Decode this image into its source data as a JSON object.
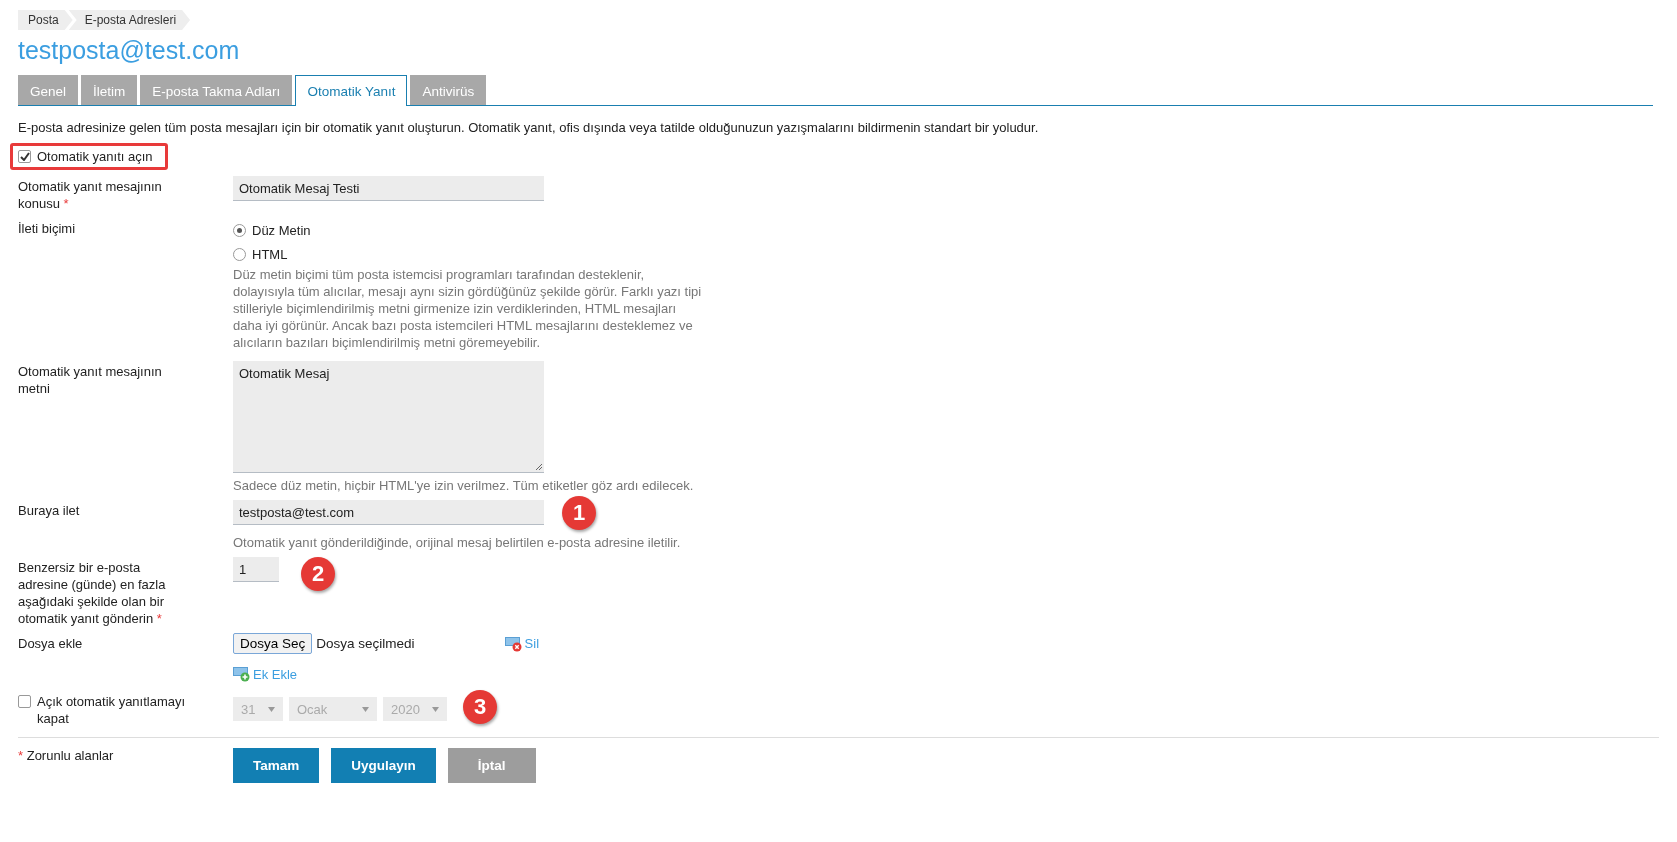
{
  "breadcrumbs": [
    "Posta",
    "E-posta Adresleri"
  ],
  "title": "testposta@test.com",
  "tabs": [
    {
      "label": "Genel",
      "selected": false
    },
    {
      "label": "İletim",
      "selected": false
    },
    {
      "label": "E-posta Takma Adları",
      "selected": false
    },
    {
      "label": "Otomatik Yanıt",
      "selected": true
    },
    {
      "label": "Antivirüs",
      "selected": false
    }
  ],
  "description": "E-posta adresinize gelen tüm posta mesajları için bir otomatik yanıt oluşturun. Otomatik yanıt, ofis dışında veya tatilde olduğunuzun yazışmalarını bildirmenin standart bir yoludur.",
  "enable_checkbox": {
    "label": "Otomatik yanıtı açın",
    "checked": true,
    "highlighted": true
  },
  "rows": [
    {
      "kind": "text",
      "label": "Otomatik yanıt mesajının konusu",
      "required_mark": "*",
      "value": "Otomatik Mesaj Testi"
    },
    {
      "kind": "radio",
      "label": "İleti biçimi",
      "options": [
        {
          "label": "Düz Metin",
          "selected": true
        },
        {
          "label": "HTML",
          "selected": false
        }
      ],
      "hint": "Düz metin biçimi tüm posta istemcisi programları tarafından desteklenir, dolayısıyla tüm alıcılar, mesajı aynı sizin gördüğünüz şekilde görür. Farklı yazı tipi stilleriyle biçimlendirilmiş metni girmenize izin verdiklerinden, HTML mesajları daha iyi görünür. Ancak bazı posta istemcileri HTML mesajlarını desteklemez ve alıcıların bazıları biçimlendirilmiş metni göremeyebilir."
    },
    {
      "kind": "textarea",
      "label": "Otomatik yanıt mesajının metni",
      "value": "Otomatik Mesaj",
      "hint": "Sadece düz metin, hiçbir HTML'ye izin verilmez. Tüm etiketler göz ardı edilecek."
    },
    {
      "kind": "text",
      "label": "Buraya ilet",
      "value": "testposta@test.com",
      "hint": "Otomatik yanıt gönderildiğinde, orijinal mesaj belirtilen e-posta adresine iletilir.",
      "annotation": "1"
    },
    {
      "kind": "number",
      "label": "Benzersiz bir e-posta adresine (günde) en fazla aşağıdaki şekilde olan bir otomatik yanıt gönderin",
      "required_mark": "*",
      "value": "1",
      "annotation": "2"
    },
    {
      "kind": "file",
      "label": "Dosya ekle",
      "button": "Dosya Seç",
      "status": "Dosya seçilmedi",
      "delete_link": "Sil",
      "add_link": "Ek Ekle"
    },
    {
      "kind": "date",
      "label": "Açık otomatik yanıtlamayı kapat",
      "checked": false,
      "selects": [
        "31",
        "Ocak",
        "2020"
      ],
      "disabled": true,
      "annotation": "3"
    }
  ],
  "required_note": {
    "mark": "*",
    "text": "Zorunlu alanlar"
  },
  "buttons": [
    {
      "label": "Tamam",
      "kind": "primary"
    },
    {
      "label": "Uygulayın",
      "kind": "primary"
    },
    {
      "label": "İptal",
      "kind": "cancel"
    }
  ]
}
